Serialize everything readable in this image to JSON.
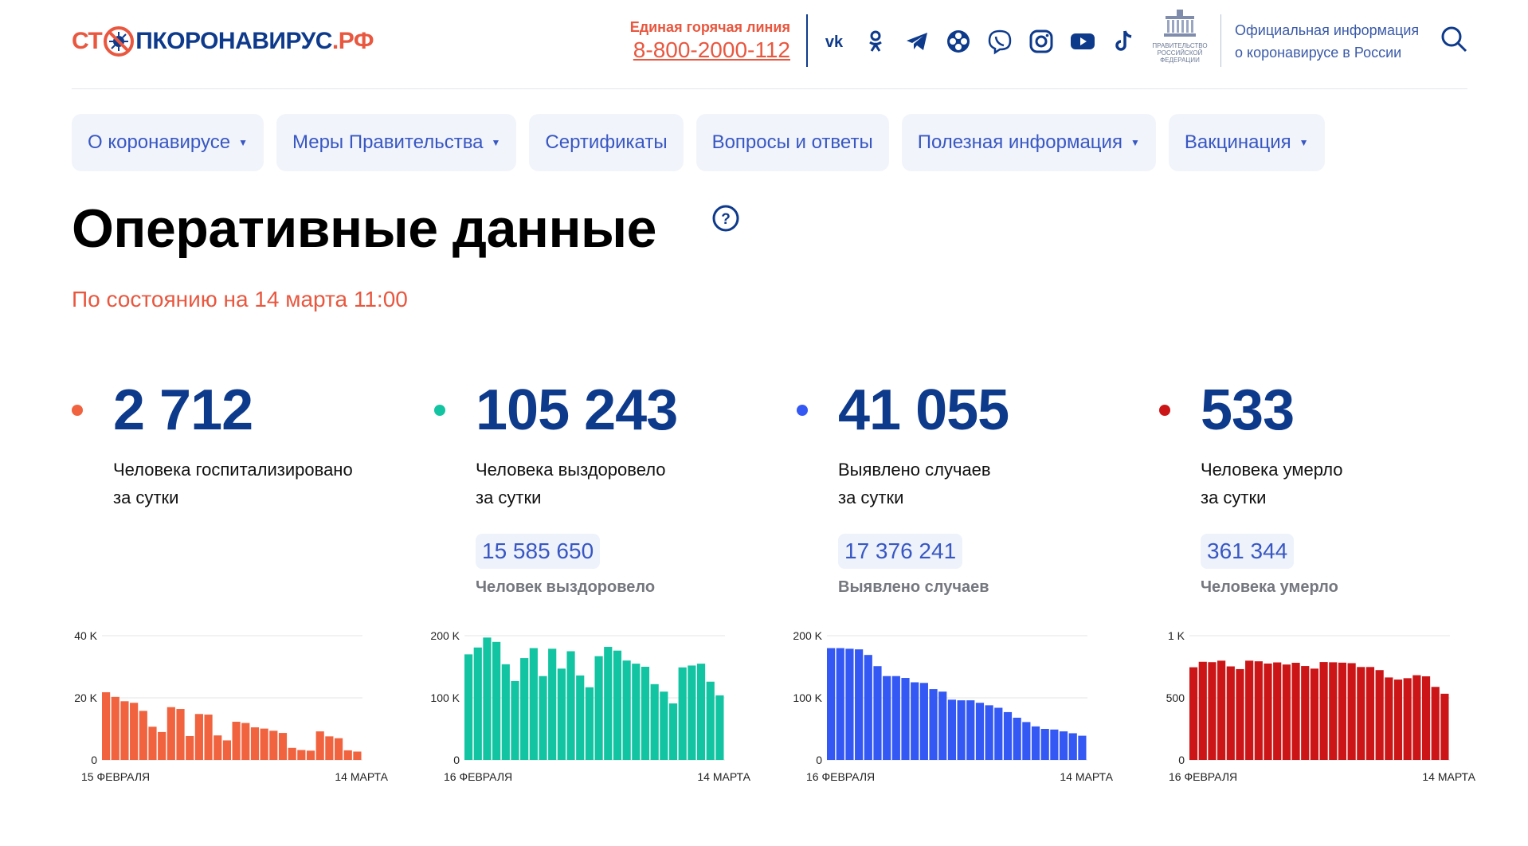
{
  "header": {
    "logo": {
      "part1": "СТ",
      "part2": "ПКОРОНАВИРУС",
      "part3": ".РФ"
    },
    "hotline_label": "Единая горячая линия",
    "hotline_phone": "8-800-2000-112",
    "socials": [
      "vk-icon",
      "odnoklassniki-icon",
      "telegram-icon",
      "yandex-zen-icon",
      "viber-icon",
      "instagram-icon",
      "youtube-icon",
      "tiktok-icon"
    ],
    "gov_emblem_text": "ПРАВИТЕЛЬСТВО РОССИЙСКОЙ ФЕДЕРАЦИИ",
    "gov_info_line1": "Официальная информация",
    "gov_info_line2": "о коронавирусе в России"
  },
  "nav": {
    "items": [
      {
        "label": "О коронавирусе",
        "has_dropdown": true
      },
      {
        "label": "Меры Правительства",
        "has_dropdown": true
      },
      {
        "label": "Сертификаты",
        "has_dropdown": false
      },
      {
        "label": "Вопросы и ответы",
        "has_dropdown": false
      },
      {
        "label": "Полезная информация",
        "has_dropdown": true
      },
      {
        "label": "Вакцинация",
        "has_dropdown": true
      }
    ]
  },
  "page": {
    "title": "Оперативные данные",
    "as_of": "По состоянию на 14 марта 11:00"
  },
  "colors": {
    "hospitalized": "#f0633e",
    "recovered": "#12c4a1",
    "cases": "#3358f4",
    "deaths": "#cc1516",
    "brand_blue": "#0e3a8c",
    "accent_orange": "#e9573f"
  },
  "stats": [
    {
      "value": "2 712",
      "desc_line1": "Человека госпитализировано",
      "desc_line2": "за сутки",
      "total": "",
      "total_label": ""
    },
    {
      "value": "105 243",
      "desc_line1": "Человека выздоровело",
      "desc_line2": "за сутки",
      "total": "15 585 650",
      "total_label": "Человек выздоровело"
    },
    {
      "value": "41 055",
      "desc_line1": "Выявлено случаев",
      "desc_line2": "за сутки",
      "total": "17 376 241",
      "total_label": "Выявлено случаев"
    },
    {
      "value": "533",
      "desc_line1": "Человека умерло",
      "desc_line2": "за сутки",
      "total": "361 344",
      "total_label": "Человека умерло"
    }
  ],
  "chart_data": [
    {
      "type": "bar",
      "ylim": [
        0,
        40000
      ],
      "yticks": [
        0,
        20000,
        40000
      ],
      "ytick_labels": [
        "0",
        "20 K",
        "40 K"
      ],
      "x_start_label": "15 ФЕВРАЛЯ",
      "x_end_label": "14 МАРТА",
      "values": [
        21800,
        20300,
        18900,
        18400,
        15800,
        10700,
        9000,
        17000,
        16400,
        7700,
        14800,
        14600,
        7900,
        6300,
        12300,
        11900,
        10500,
        10100,
        9400,
        8700,
        3900,
        3200,
        3000,
        9200,
        7600,
        7000,
        3100,
        2700
      ]
    },
    {
      "type": "bar",
      "ylim": [
        0,
        200000
      ],
      "yticks": [
        0,
        100000,
        200000
      ],
      "ytick_labels": [
        "0",
        "100 K",
        "200 K"
      ],
      "x_start_label": "16 ФЕВРАЛЯ",
      "x_end_label": "14 МАРТА",
      "values": [
        170000,
        181000,
        197000,
        190000,
        154000,
        127000,
        164000,
        180000,
        135000,
        179000,
        147000,
        175000,
        136000,
        117000,
        167000,
        182000,
        176000,
        160000,
        155000,
        150000,
        122000,
        110000,
        91000,
        149000,
        152000,
        155000,
        126000,
        104000
      ]
    },
    {
      "type": "bar",
      "ylim": [
        0,
        200000
      ],
      "yticks": [
        0,
        100000,
        200000
      ],
      "ytick_labels": [
        "0",
        "100 K",
        "200 K"
      ],
      "x_start_label": "16 ФЕВРАЛЯ",
      "x_end_label": "14 МАРТА",
      "values": [
        180000,
        180000,
        179000,
        178000,
        169000,
        151000,
        135000,
        135000,
        132000,
        125000,
        124000,
        114000,
        110000,
        97000,
        96000,
        96000,
        92000,
        88000,
        84000,
        77000,
        68000,
        61000,
        54000,
        50000,
        49000,
        46000,
        43000,
        39000
      ]
    },
    {
      "type": "bar",
      "ylim": [
        0,
        1000
      ],
      "yticks": [
        0,
        500,
        1000
      ],
      "ytick_labels": [
        "0",
        "500",
        "1 K"
      ],
      "x_start_label": "16 ФЕВРАЛЯ",
      "x_end_label": "14 МАРТА",
      "values": [
        746,
        790,
        787,
        799,
        753,
        731,
        799,
        794,
        776,
        785,
        768,
        782,
        756,
        735,
        788,
        786,
        783,
        779,
        748,
        748,
        723,
        664,
        647,
        658,
        682,
        673,
        588,
        533
      ]
    }
  ]
}
